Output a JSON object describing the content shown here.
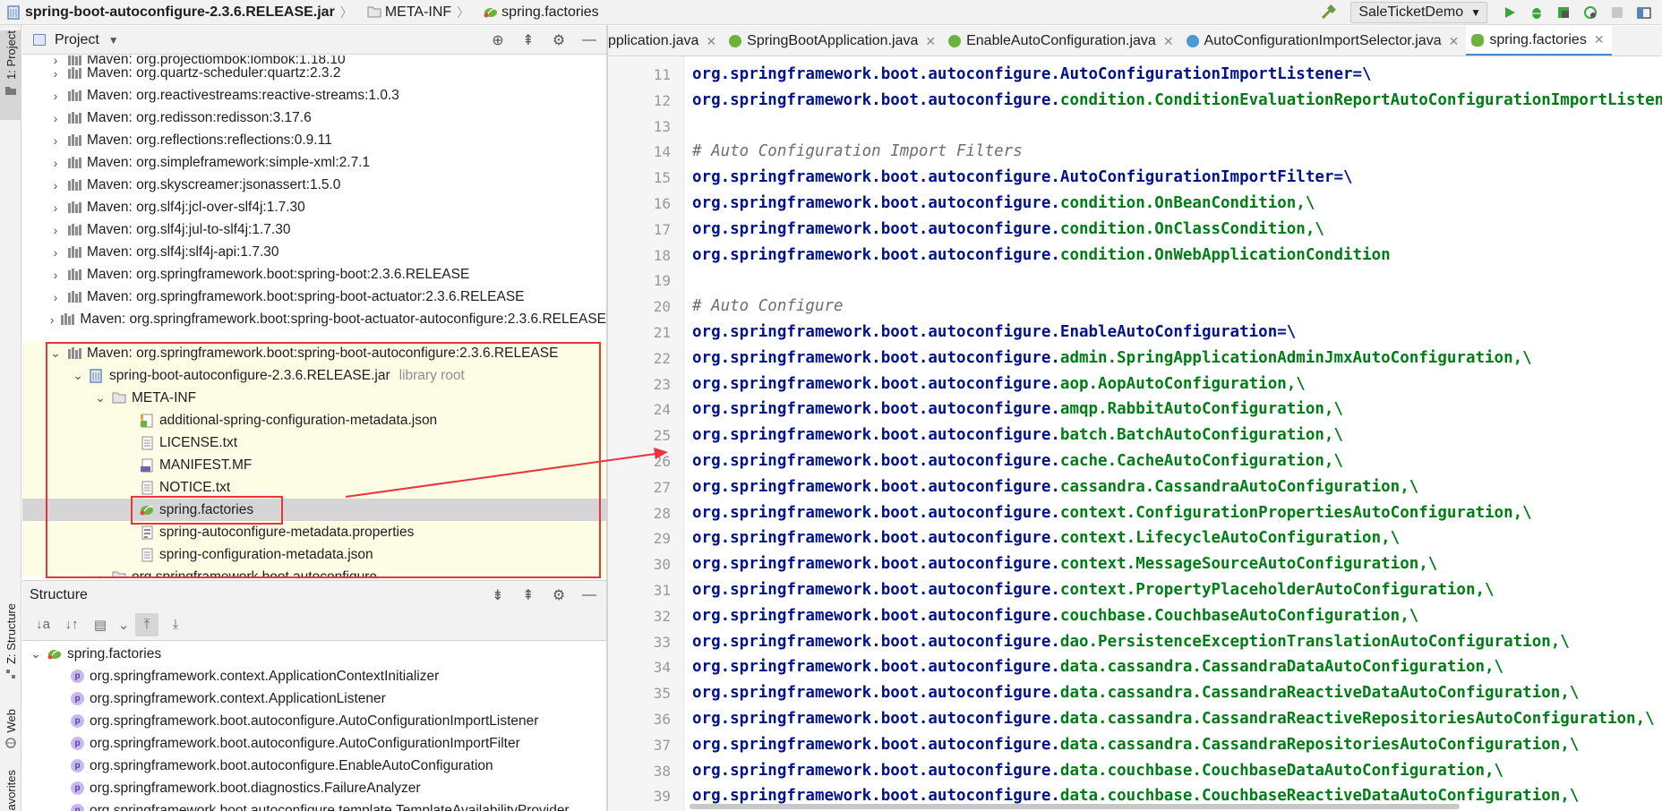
{
  "navbar": {
    "crumbs": [
      "spring-boot-autoconfigure-2.3.6.RELEASE.jar",
      "META-INF",
      "spring.factories"
    ],
    "run_config": "SaleTicketDemo",
    "icons": [
      "hammer-icon",
      "run-icon",
      "debug-icon",
      "coverage-icon",
      "profile-icon",
      "stop-icon",
      "project-structure-icon"
    ]
  },
  "stripe": {
    "project_tab": "1: Project",
    "structure_tab": "Z: Structure",
    "web_tab": "Web",
    "favorites_tab": "Favorites"
  },
  "project_panel": {
    "title": "Project",
    "rows": [
      {
        "label": "Maven: org.projectlombok:lombok:1.18.10"
      },
      {
        "label": "Maven: org.quartz-scheduler:quartz:2.3.2"
      },
      {
        "label": "Maven: org.reactivestreams:reactive-streams:1.0.3"
      },
      {
        "label": "Maven: org.redisson:redisson:3.17.6"
      },
      {
        "label": "Maven: org.reflections:reflections:0.9.11"
      },
      {
        "label": "Maven: org.simpleframework:simple-xml:2.7.1"
      },
      {
        "label": "Maven: org.skyscreamer:jsonassert:1.5.0"
      },
      {
        "label": "Maven: org.slf4j:jcl-over-slf4j:1.7.30"
      },
      {
        "label": "Maven: org.slf4j:jul-to-slf4j:1.7.30"
      },
      {
        "label": "Maven: org.slf4j:slf4j-api:1.7.30"
      },
      {
        "label": "Maven: org.springframework.boot:spring-boot:2.3.6.RELEASE"
      },
      {
        "label": "Maven: org.springframework.boot:spring-boot-actuator:2.3.6.RELEASE"
      },
      {
        "label": "Maven: org.springframework.boot:spring-boot-actuator-autoconfigure:2.3.6.RELEASE"
      },
      {
        "label": "Maven: org.springframework.boot:spring-boot-autoconfigure:2.3.6.RELEASE"
      },
      {
        "label": "spring-boot-autoconfigure-2.3.6.RELEASE.jar",
        "note": "library root"
      },
      {
        "label": "META-INF"
      },
      {
        "label": "additional-spring-configuration-metadata.json"
      },
      {
        "label": "LICENSE.txt"
      },
      {
        "label": "MANIFEST.MF"
      },
      {
        "label": "NOTICE.txt"
      },
      {
        "label": "spring.factories"
      },
      {
        "label": "spring-autoconfigure-metadata.properties"
      },
      {
        "label": "spring-configuration-metadata.json"
      },
      {
        "label": "org.springframework.boot.autoconfigure"
      }
    ]
  },
  "structure_panel": {
    "title": "Structure",
    "root": "spring.factories",
    "items": [
      "org.springframework.context.ApplicationContextInitializer",
      "org.springframework.context.ApplicationListener",
      "org.springframework.boot.autoconfigure.AutoConfigurationImportListener",
      "org.springframework.boot.autoconfigure.AutoConfigurationImportFilter",
      "org.springframework.boot.autoconfigure.EnableAutoConfiguration",
      "org.springframework.boot.diagnostics.FailureAnalyzer",
      "org.springframework.boot.autoconfigure.template.TemplateAvailabilityProvider"
    ],
    "badge": "p"
  },
  "tabs": [
    {
      "label": "pplication.java",
      "icon": "java-class-icon"
    },
    {
      "label": "SpringBootApplication.java",
      "icon": "annotation-icon"
    },
    {
      "label": "EnableAutoConfiguration.java",
      "icon": "annotation-icon"
    },
    {
      "label": "AutoConfigurationImportSelector.java",
      "icon": "class-icon"
    },
    {
      "label": "spring.factories",
      "icon": "spring-leaf-icon",
      "active": true
    }
  ],
  "editor": {
    "lines": [
      {
        "n": "11",
        "pkg": "org.springframework.boot.autoconfigure.",
        "rest": "AutoConfigurationImportListener=\\"
      },
      {
        "n": "12",
        "pkg": "org.springframework.boot.autoconfigure.",
        "rest": "condition.ConditionEvaluationReportAutoConfigurationImportListener"
      },
      {
        "n": "13",
        "pkg": "",
        "rest": ""
      },
      {
        "n": "14",
        "comment": "# Auto Configuration Import Filters"
      },
      {
        "n": "15",
        "pkg": "org.springframework.boot.autoconfigure.",
        "rest": "AutoConfigurationImportFilter=\\"
      },
      {
        "n": "16",
        "pkg": "org.springframework.boot.autoconfigure.",
        "rest": "condition.OnBeanCondition,\\"
      },
      {
        "n": "17",
        "pkg": "org.springframework.boot.autoconfigure.",
        "rest": "condition.OnClassCondition,\\"
      },
      {
        "n": "18",
        "pkg": "org.springframework.boot.autoconfigure.",
        "rest": "condition.OnWebApplicationCondition"
      },
      {
        "n": "19",
        "pkg": "",
        "rest": ""
      },
      {
        "n": "20",
        "comment": "# Auto Configure"
      },
      {
        "n": "21",
        "pkg": "org.springframework.boot.autoconfigure.",
        "rest": "EnableAutoConfiguration=\\"
      },
      {
        "n": "22",
        "pkg": "org.springframework.boot.autoconfigure.",
        "rest": "admin.SpringApplicationAdminJmxAutoConfiguration,\\"
      },
      {
        "n": "23",
        "pkg": "org.springframework.boot.autoconfigure.",
        "rest": "aop.AopAutoConfiguration,\\"
      },
      {
        "n": "24",
        "pkg": "org.springframework.boot.autoconfigure.",
        "rest": "amqp.RabbitAutoConfiguration,\\"
      },
      {
        "n": "25",
        "pkg": "org.springframework.boot.autoconfigure.",
        "rest": "batch.BatchAutoConfiguration,\\"
      },
      {
        "n": "26",
        "pkg": "org.springframework.boot.autoconfigure.",
        "rest": "cache.CacheAutoConfiguration,\\"
      },
      {
        "n": "27",
        "pkg": "org.springframework.boot.autoconfigure.",
        "rest": "cassandra.CassandraAutoConfiguration,\\"
      },
      {
        "n": "28",
        "pkg": "org.springframework.boot.autoconfigure.",
        "rest": "context.ConfigurationPropertiesAutoConfiguration,\\"
      },
      {
        "n": "29",
        "pkg": "org.springframework.boot.autoconfigure.",
        "rest": "context.LifecycleAutoConfiguration,\\"
      },
      {
        "n": "30",
        "pkg": "org.springframework.boot.autoconfigure.",
        "rest": "context.MessageSourceAutoConfiguration,\\"
      },
      {
        "n": "31",
        "pkg": "org.springframework.boot.autoconfigure.",
        "rest": "context.PropertyPlaceholderAutoConfiguration,\\"
      },
      {
        "n": "32",
        "pkg": "org.springframework.boot.autoconfigure.",
        "rest": "couchbase.CouchbaseAutoConfiguration,\\"
      },
      {
        "n": "33",
        "pkg": "org.springframework.boot.autoconfigure.",
        "rest": "dao.PersistenceExceptionTranslationAutoConfiguration,\\"
      },
      {
        "n": "34",
        "pkg": "org.springframework.boot.autoconfigure.",
        "rest": "data.cassandra.CassandraDataAutoConfiguration,\\"
      },
      {
        "n": "35",
        "pkg": "org.springframework.boot.autoconfigure.",
        "rest": "data.cassandra.CassandraReactiveDataAutoConfiguration,\\"
      },
      {
        "n": "36",
        "pkg": "org.springframework.boot.autoconfigure.",
        "rest": "data.cassandra.CassandraReactiveRepositoriesAutoConfiguration,\\"
      },
      {
        "n": "37",
        "pkg": "org.springframework.boot.autoconfigure.",
        "rest": "data.cassandra.CassandraRepositoriesAutoConfiguration,\\"
      },
      {
        "n": "38",
        "pkg": "org.springframework.boot.autoconfigure.",
        "rest": "data.couchbase.CouchbaseDataAutoConfiguration,\\"
      },
      {
        "n": "39",
        "pkg": "org.springframework.boot.autoconfigure.",
        "rest": "data.couchbase.CouchbaseReactiveDataAutoConfiguration,\\"
      }
    ]
  },
  "colors": {
    "annotation_red": "#e8343a",
    "code_green": "#007d17",
    "code_blue": "#00138a",
    "comment_gray": "#6e6e6e",
    "highlight_yellow": "#fdfde6",
    "tab_active_underline": "#4a88c7"
  }
}
